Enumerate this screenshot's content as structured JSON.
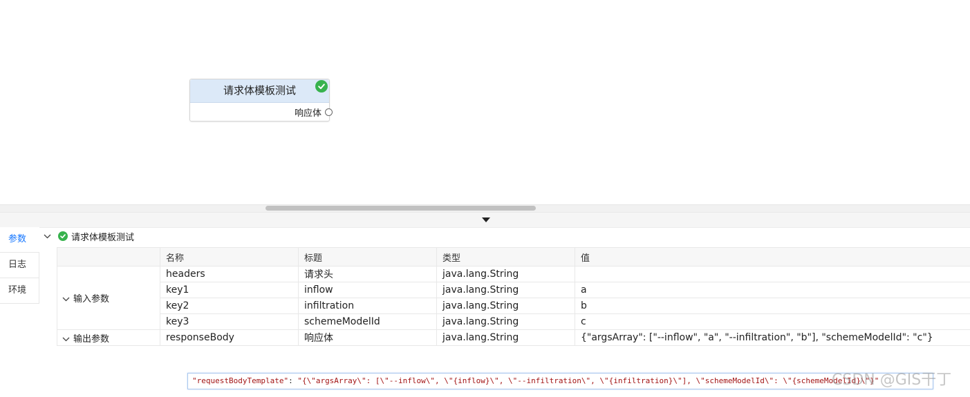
{
  "node": {
    "title": "请求体模板测试",
    "port_label": "响应体"
  },
  "side_tabs": [
    {
      "label": "参数",
      "active": true
    },
    {
      "label": "日志",
      "active": false
    },
    {
      "label": "环境",
      "active": false
    }
  ],
  "tree": {
    "label": "请求体模板测试"
  },
  "table": {
    "columns": [
      "名称",
      "标题",
      "类型",
      "值"
    ],
    "groups": [
      {
        "label": "输入参数",
        "rows": [
          {
            "name": "headers",
            "title": "请求头",
            "type": "java.lang.String",
            "value": ""
          },
          {
            "name": "key1",
            "title": "inflow",
            "type": "java.lang.String",
            "value": "a"
          },
          {
            "name": "key2",
            "title": "infiltration",
            "type": "java.lang.String",
            "value": "b"
          },
          {
            "name": "key3",
            "title": "schemeModelId",
            "type": "java.lang.String",
            "value": "c"
          }
        ]
      },
      {
        "label": "输出参数",
        "rows": [
          {
            "name": "responseBody",
            "title": "响应体",
            "type": "java.lang.String",
            "value": "{\"argsArray\": [\"--inflow\", \"a\", \"--infiltration\", \"b\"], \"schemeModelId\": \"c\"}"
          }
        ]
      }
    ]
  },
  "code_snippet": {
    "key": "\"requestBodyTemplate\"",
    "sep": ": ",
    "value": "\"{\\\"argsArray\\\": [\\\"--inflow\\\", \\\"{inflow}\\\", \\\"--infiltration\\\", \\\"{infiltration}\\\"], \\\"schemeModelId\\\": \\\"{schemeModelId}\\\"}\""
  },
  "watermark": "CSDN @GIS干丁",
  "colors": {
    "accent": "#1677ff",
    "success": "#37b24d",
    "node_header": "#dce9f8"
  }
}
